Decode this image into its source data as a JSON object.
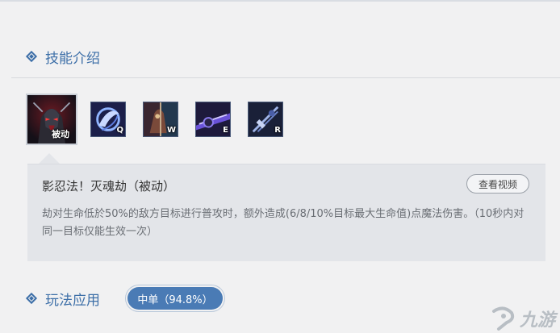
{
  "skill_section": {
    "title": "技能介绍"
  },
  "skills": [
    {
      "key": "被动",
      "icon": "passive-skill-icon",
      "selected": true
    },
    {
      "key": "Q",
      "icon": "q-skill-icon"
    },
    {
      "key": "W",
      "icon": "w-skill-icon"
    },
    {
      "key": "E",
      "icon": "e-skill-icon"
    },
    {
      "key": "R",
      "icon": "r-skill-icon"
    }
  ],
  "detail": {
    "name": "影忍法！灭魂劫（被动）",
    "video_label": "查看视频",
    "description": "劫对生命低於50%的敌方目标进行普攻时，额外造成(6/8/10%目标最大生命值)点魔法伤害。（10秒内对同一目标仅能生效一次）"
  },
  "play_section": {
    "title": "玩法应用"
  },
  "role_badge": {
    "label": "中单（94.8%）"
  },
  "watermark": {
    "text": "九游"
  },
  "colors": {
    "accent": "#3d6fa8",
    "badge": "#4a7bb5",
    "panel": "#e3e5e9"
  }
}
